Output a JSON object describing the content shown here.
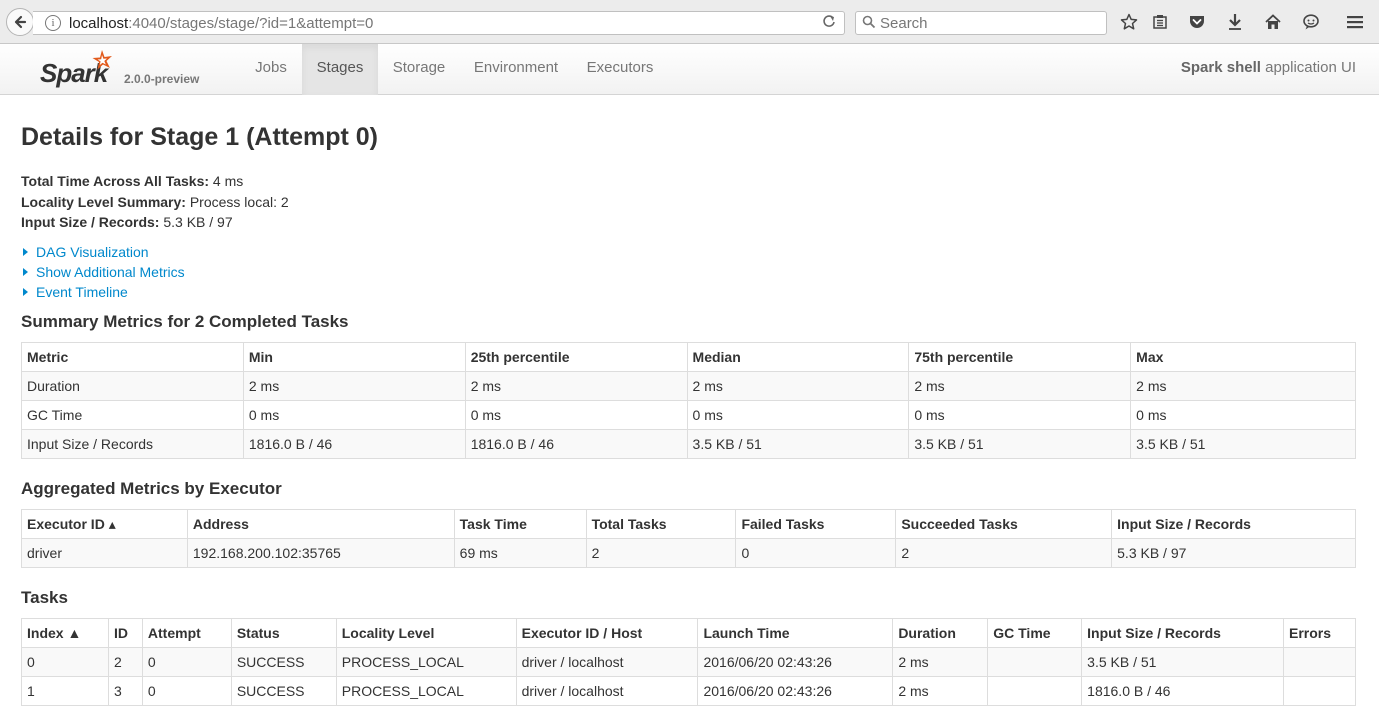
{
  "browser": {
    "url_host": "localhost",
    "url_rest": ":4040/stages/stage/?id=1&attempt=0",
    "search_placeholder": "Search"
  },
  "navbar": {
    "brand_name": "Spark",
    "version": "2.0.0-preview",
    "tabs": [
      {
        "label": "Jobs",
        "active": false
      },
      {
        "label": "Stages",
        "active": true
      },
      {
        "label": "Storage",
        "active": false
      },
      {
        "label": "Environment",
        "active": false
      },
      {
        "label": "Executors",
        "active": false
      }
    ],
    "app_name_bold": "Spark shell",
    "app_name_rest": " application UI"
  },
  "page": {
    "title": "Details for Stage 1 (Attempt 0)",
    "summary": [
      {
        "label": "Total Time Across All Tasks:",
        "value": " 4 ms"
      },
      {
        "label": "Locality Level Summary:",
        "value": " Process local: 2"
      },
      {
        "label": "Input Size / Records:",
        "value": " 5.3 KB / 97"
      }
    ],
    "toggles": [
      "DAG Visualization",
      "Show Additional Metrics",
      "Event Timeline"
    ]
  },
  "summary_metrics": {
    "heading": "Summary Metrics for 2 Completed Tasks",
    "columns": [
      "Metric",
      "Min",
      "25th percentile",
      "Median",
      "75th percentile",
      "Max"
    ],
    "rows": [
      [
        "Duration",
        "2 ms",
        "2 ms",
        "2 ms",
        "2 ms",
        "2 ms"
      ],
      [
        "GC Time",
        "0 ms",
        "0 ms",
        "0 ms",
        "0 ms",
        "0 ms"
      ],
      [
        "Input Size / Records",
        "1816.0 B / 46",
        "1816.0 B / 46",
        "3.5 KB / 51",
        "3.5 KB / 51",
        "3.5 KB / 51"
      ]
    ]
  },
  "executor_metrics": {
    "heading": "Aggregated Metrics by Executor",
    "columns": [
      "Executor ID ▴",
      "Address",
      "Task Time",
      "Total Tasks",
      "Failed Tasks",
      "Succeeded Tasks",
      "Input Size / Records"
    ],
    "rows": [
      [
        "driver",
        "192.168.200.102:35765",
        "69 ms",
        "2",
        "0",
        "2",
        "5.3 KB / 97"
      ]
    ]
  },
  "tasks": {
    "heading": "Tasks",
    "columns": [
      "Index ▲",
      "ID",
      "Attempt",
      "Status",
      "Locality Level",
      "Executor ID / Host",
      "Launch Time",
      "Duration",
      "GC Time",
      "Input Size / Records",
      "Errors"
    ],
    "rows": [
      [
        "0",
        "2",
        "0",
        "SUCCESS",
        "PROCESS_LOCAL",
        "driver / localhost",
        "2016/06/20 02:43:26",
        "2 ms",
        "",
        "3.5 KB / 51",
        ""
      ],
      [
        "1",
        "3",
        "0",
        "SUCCESS",
        "PROCESS_LOCAL",
        "driver / localhost",
        "2016/06/20 02:43:26",
        "2 ms",
        "",
        "1816.0 B / 46",
        ""
      ]
    ]
  }
}
